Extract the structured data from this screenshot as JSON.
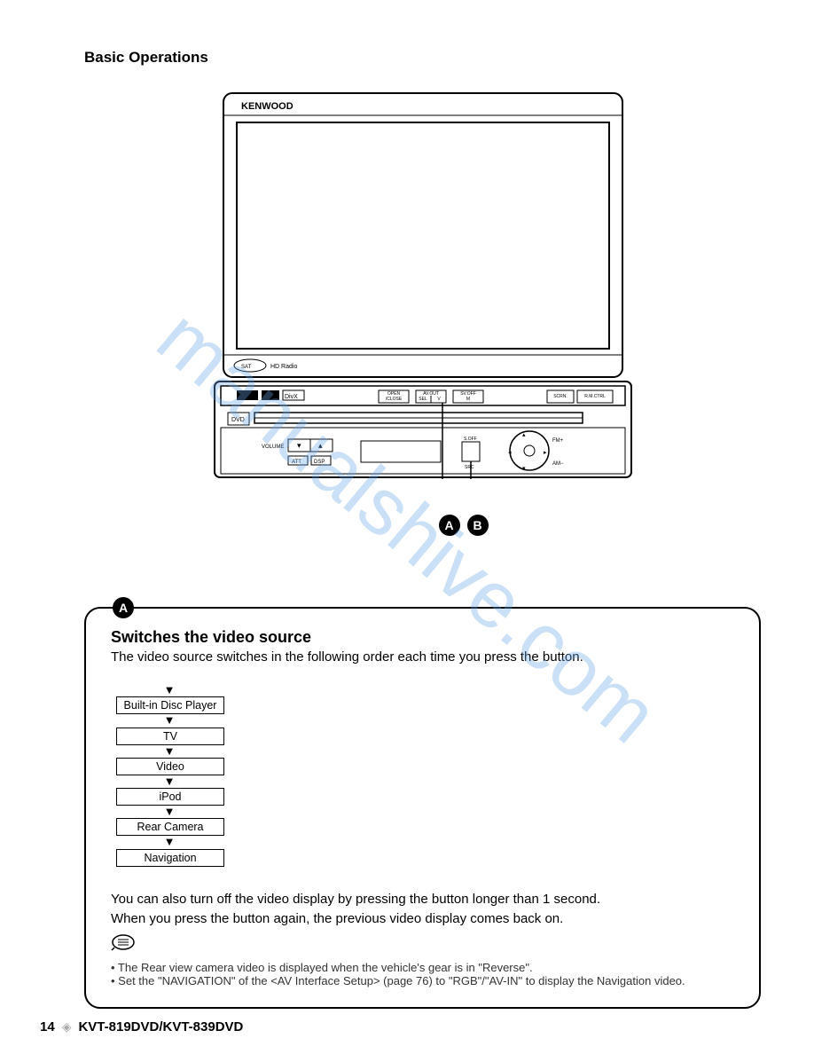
{
  "header": {
    "section_title": "Basic Operations"
  },
  "device": {
    "brand": "KENWOOD",
    "badges": {
      "sat": "SAT",
      "hdradio": "HD Radio"
    },
    "panel": {
      "dolby": "DOLBY",
      "dts": "dts",
      "divx": "DivX",
      "open_close": "OPEN / CLOSE",
      "av_out": "AV.OUT",
      "sel": "SEL",
      "v": "V",
      "svoff": "SV.OFF",
      "m": "M",
      "scrn": "SCRN.",
      "rmctrl": "R.M.CTRL"
    },
    "body": {
      "dvd": "DVD",
      "volume": "VOLUME",
      "att": "ATT",
      "dsp": "DSP",
      "soff": "S.OFF",
      "src": "SRC",
      "fmplus": "FM+",
      "amminus": "AM−"
    }
  },
  "callouts": {
    "a": "A",
    "b": "B"
  },
  "box": {
    "badge": "A",
    "title": "Switches the video source",
    "desc": "The video source switches in the following order each time you press the button.",
    "flow": [
      "Built-in Disc Player",
      "TV",
      "Video",
      "iPod",
      "Rear Camera",
      "Navigation"
    ],
    "para1": "You can also turn off the video display by pressing the button longer than 1 second.",
    "para2": "When you press the button again, the previous video display comes back on.",
    "bullet1": "•  The Rear view camera video is displayed when the vehicle's gear is in \"Reverse\".",
    "bullet2": "•  Set the \"NAVIGATION\" of the <AV Interface Setup> (page 76) to \"RGB\"/\"AV-IN\" to display the Navigation video."
  },
  "footer": {
    "page": "14",
    "model": "KVT-819DVD/KVT-839DVD"
  },
  "watermark": "manualshive.com"
}
